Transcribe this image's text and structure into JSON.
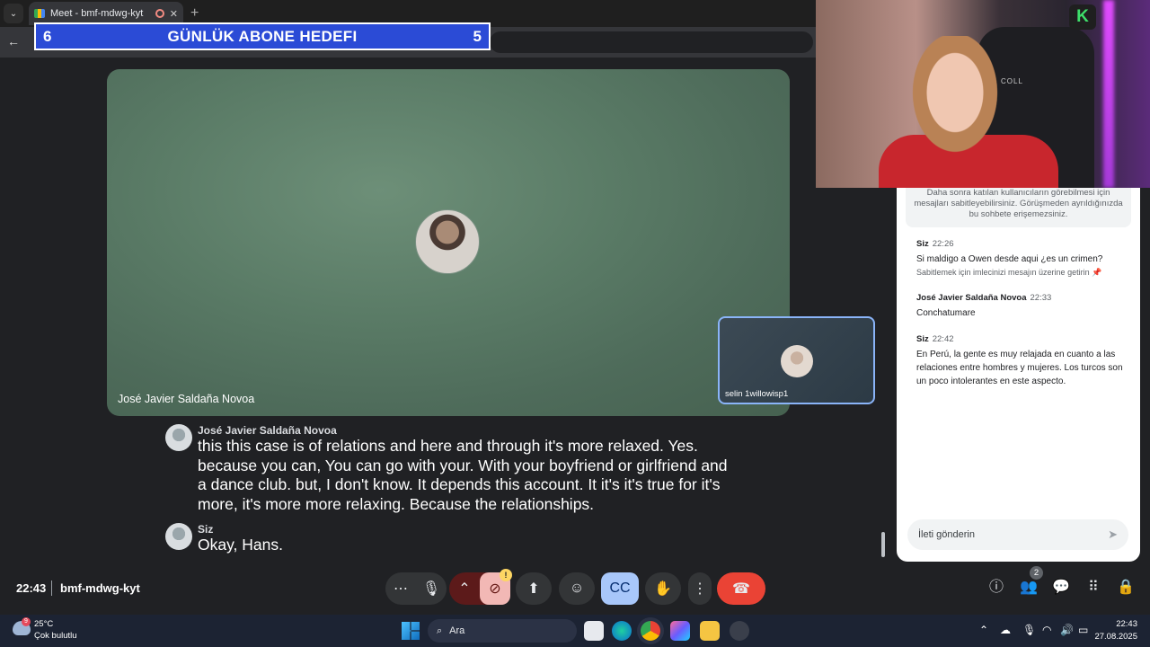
{
  "browser": {
    "tab_title": "Meet - bmf-mdwg-kyt",
    "tab_close": "✕",
    "new_tab": "+",
    "back": "←"
  },
  "overlay_banner": {
    "left_number": "6",
    "title": "GÜNLÜK ABONE HEDEFI",
    "right_number": "5"
  },
  "main_tile": {
    "participant_name": "José Javier Saldaña Novoa"
  },
  "self_tile": {
    "participant_name": "selin 1willowisp1"
  },
  "captions": [
    {
      "speaker": "José Javier Saldaña Novoa",
      "text": "this this case is of relations and here and through it's more relaxed. Yes. because you can, You can go with your. With your boyfriend or girlfriend and a dance club. but, I don't know. It depends this account. It it's it's true for it's more, it's more more relaxing. Because the relationships."
    },
    {
      "speaker": "Siz",
      "text": "Okay, Hans."
    }
  ],
  "chat": {
    "notice": "Daha sonra katılan kullanıcıların görebilmesi için mesajları sabitleyebilirsiniz. Görüşmeden ayrıldığınızda bu sohbete erişemezsiniz.",
    "messages": [
      {
        "sender": "Siz",
        "time": "22:26",
        "text": "Si maldigo a Owen desde aqui ¿es un crimen?",
        "hint": "Sabitlemek için imlecinizi mesajın üzerine getirin"
      },
      {
        "sender": "José Javier Saldaña Novoa",
        "time": "22:33",
        "text": "Conchatumare"
      },
      {
        "sender": "Siz",
        "time": "22:42",
        "text": "En Perú, la gente es muy relajada en cuanto a las relaciones entre hombres y mujeres. Los turcos son un poco intolerantes en este aspecto."
      }
    ],
    "input_placeholder": "İleti gönderin"
  },
  "webcam": {
    "logo_letter": "K",
    "chair_brand": "COLL"
  },
  "meet_bar": {
    "time": "22:43",
    "meeting_code": "bmf-mdwg-kyt",
    "warning_badge": "!",
    "people_count": "2"
  },
  "taskbar": {
    "weather_badge": "9",
    "temperature": "25°C",
    "condition": "Çok bulutlu",
    "search_label": "Ara",
    "clock_time": "22:43",
    "clock_date": "27.08.2025"
  },
  "colors": {
    "banner_bg": "#2b4bd6",
    "leave_button": "#ea4335",
    "captions_active": "#a8c7fa",
    "accent_blue": "#8ab4f8"
  },
  "icons": [
    "tab-list-icon",
    "meet-favicon",
    "recording-icon",
    "back-arrow-icon",
    "send-icon",
    "more-options-icon",
    "mic-icon",
    "chevron-up-icon",
    "camera-off-icon",
    "present-icon",
    "emoji-icon",
    "captions-icon",
    "raise-hand-icon",
    "more-vert-icon",
    "hang-up-icon",
    "info-icon",
    "people-icon",
    "chat-icon",
    "activities-icon",
    "host-controls-icon",
    "windows-start-icon",
    "search-icon",
    "wifi-icon",
    "volume-icon",
    "battery-icon"
  ]
}
